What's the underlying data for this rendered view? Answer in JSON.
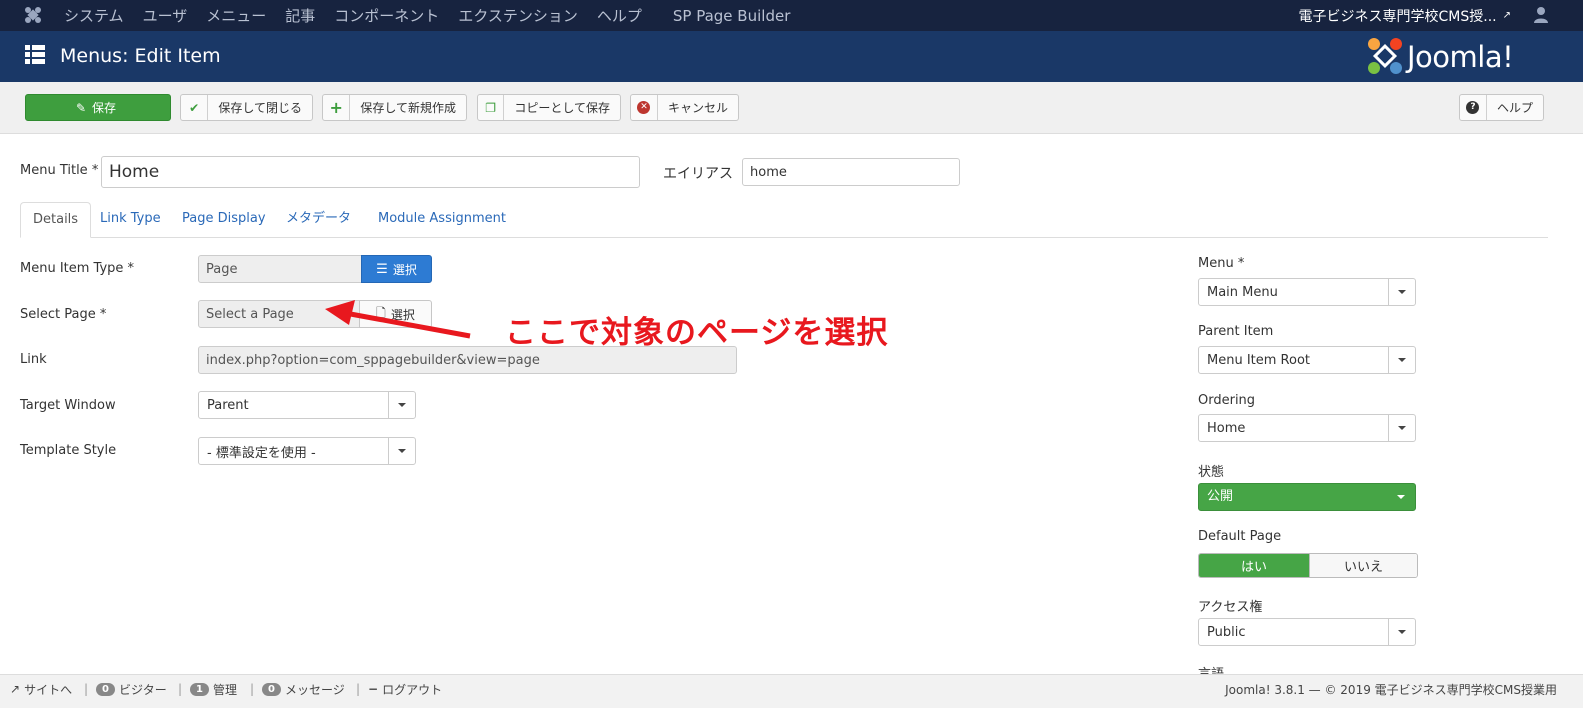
{
  "topnav": {
    "menu": [
      "システム",
      "ユーザ",
      "メニュー",
      "記事",
      "コンポーネント",
      "エクステンション",
      "ヘルプ",
      "SP Page Builder"
    ],
    "site_name": "電子ビジネス専門学校CMS授..."
  },
  "header": {
    "title": "Menus: Edit Item",
    "brand": "Joomla!"
  },
  "toolbar": {
    "save": "保存",
    "save_close": "保存して閉じる",
    "save_new": "保存して新規作成",
    "save_copy": "コピーとして保存",
    "cancel": "キャンセル",
    "help": "ヘルプ"
  },
  "form": {
    "menu_title_label": "Menu Title *",
    "menu_title_value": "Home",
    "alias_label": "エイリアス",
    "alias_value": "home"
  },
  "tabs": [
    "Details",
    "Link Type",
    "Page Display",
    "メタデータ",
    "Module Assignment"
  ],
  "details": {
    "item_type_label": "Menu Item Type *",
    "item_type_value": "Page",
    "select_button": "選択",
    "select_page_label": "Select Page *",
    "select_page_value": "Select a Page",
    "link_label": "Link",
    "link_value": "index.php?option=com_sppagebuilder&view=page",
    "target_label": "Target Window",
    "target_value": "Parent",
    "template_label": "Template Style",
    "template_value": "- 標準設定を使用 -"
  },
  "annotation": "ここで対象のページを選択",
  "sidebar": {
    "menu_label": "Menu *",
    "menu_value": "Main Menu",
    "parent_label": "Parent Item",
    "parent_value": "Menu Item Root",
    "ordering_label": "Ordering",
    "ordering_value": "Home",
    "status_label": "状態",
    "status_value": "公開",
    "default_label": "Default Page",
    "default_yes": "はい",
    "default_no": "いいえ",
    "access_label": "アクセス権",
    "access_value": "Public",
    "language_label": "言語"
  },
  "statusbar": {
    "site": "サイトへ",
    "visitors_count": "0",
    "visitors": "ビジター",
    "admins_count": "1",
    "admins": "管理",
    "messages_count": "0",
    "messages": "メッセージ",
    "logout": "ログアウト",
    "footer": "Joomla! 3.8.1 — © 2019 電子ビジネス専門学校CMS授業用"
  },
  "colors": {
    "topnav_bg": "#17233f",
    "header_bg": "#1a3867",
    "save_green": "#3e9e3e",
    "select_blue": "#2d7bd3",
    "annotation_red": "#e8181e",
    "link_blue": "#2a69b8"
  }
}
